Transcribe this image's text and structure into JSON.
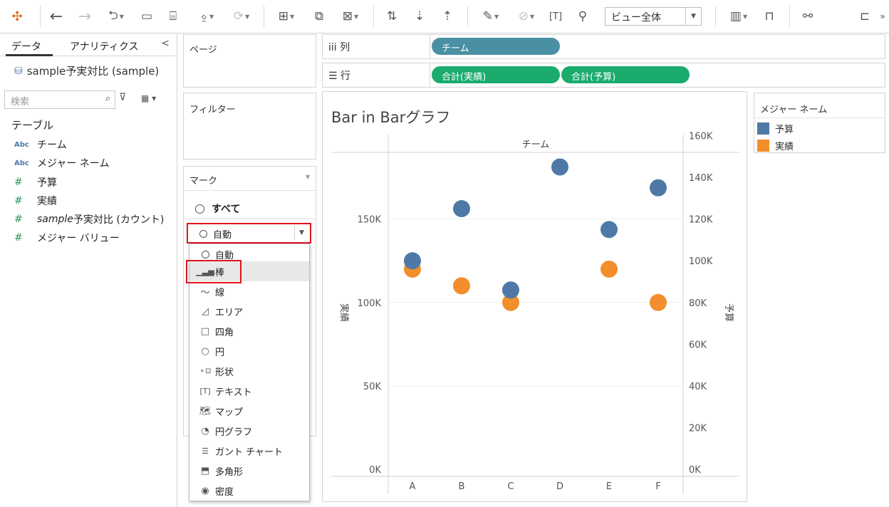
{
  "colors": {
    "budget": "#4e79a7",
    "actual": "#f28e2b",
    "pill_dim": "#4a90a4",
    "pill_measure": "#1aab6d",
    "highlight_red": "#e0141e"
  },
  "toolbar": {
    "icons": [
      "tableau-logo-icon",
      "back-icon",
      "forward-icon",
      "redo-icon",
      "save-icon",
      "new-datasource-icon",
      "pause-icon",
      "refresh-icon",
      "new-sheet-icon",
      "duplicate-icon",
      "clear-icon",
      "swap-icon",
      "sort-asc-icon",
      "sort-desc-icon",
      "highlight-icon",
      "attach-icon",
      "text-label-icon",
      "pin-icon",
      "bar-icon",
      "presentation-icon",
      "share-icon",
      "signpost-icon"
    ],
    "fit_value": "ビュー全体"
  },
  "datapane": {
    "tab_data": "データ",
    "tab_analytics": "アナリティクス",
    "collapse": "<",
    "datasource": "sample予実対比 (sample)",
    "search_placeholder": "検索",
    "section": "テーブル",
    "fields": [
      {
        "type": "Abc",
        "name": "チーム"
      },
      {
        "type": "Abc",
        "name": "メジャー ネーム"
      },
      {
        "type": "#",
        "name": "予算"
      },
      {
        "type": "#",
        "name": "実績"
      },
      {
        "type": "#",
        "name_italic": "sample",
        "name": "予実対比 (カウント)"
      },
      {
        "type": "#",
        "name": "メジャー バリュー"
      }
    ]
  },
  "cards": {
    "pages": "ページ",
    "filters": "フィルター",
    "marks": "マーク",
    "all": "すべて"
  },
  "marks_selector": {
    "value": "自動"
  },
  "mark_options": [
    "自動",
    "棒",
    "線",
    "エリア",
    "四角",
    "円",
    "形状",
    "テキスト",
    "マップ",
    "円グラフ",
    "ガント チャート",
    "多角形",
    "密度"
  ],
  "shelves": {
    "columns_label": "iii 列",
    "rows_label": "☰ 行",
    "column_pills": [
      "チーム"
    ],
    "row_pills": [
      "合計(実績)",
      "合計(予算)"
    ]
  },
  "legend": {
    "title": "メジャー ネーム",
    "items": [
      "予算",
      "実績"
    ]
  },
  "chart_data": {
    "type": "scatter",
    "title": "Bar in Barグラフ",
    "header": "チーム",
    "categories": [
      "A",
      "B",
      "C",
      "D",
      "E",
      "F"
    ],
    "left_axis": {
      "label": "実績",
      "ticks": [
        "150K",
        "100K",
        "50K",
        "0K"
      ],
      "range": [
        0,
        190000
      ]
    },
    "right_axis": {
      "label": "予算",
      "ticks": [
        "160K",
        "140K",
        "120K",
        "100K",
        "80K",
        "60K",
        "40K",
        "20K",
        "0K"
      ],
      "range": [
        0,
        152000
      ]
    },
    "series": [
      {
        "name": "予算",
        "axis": "right",
        "values": [
          100000,
          125000,
          86000,
          145000,
          115000,
          135000
        ]
      },
      {
        "name": "実績",
        "axis": "left",
        "values": [
          120000,
          110000,
          100000,
          null,
          120000,
          100000
        ]
      }
    ]
  }
}
